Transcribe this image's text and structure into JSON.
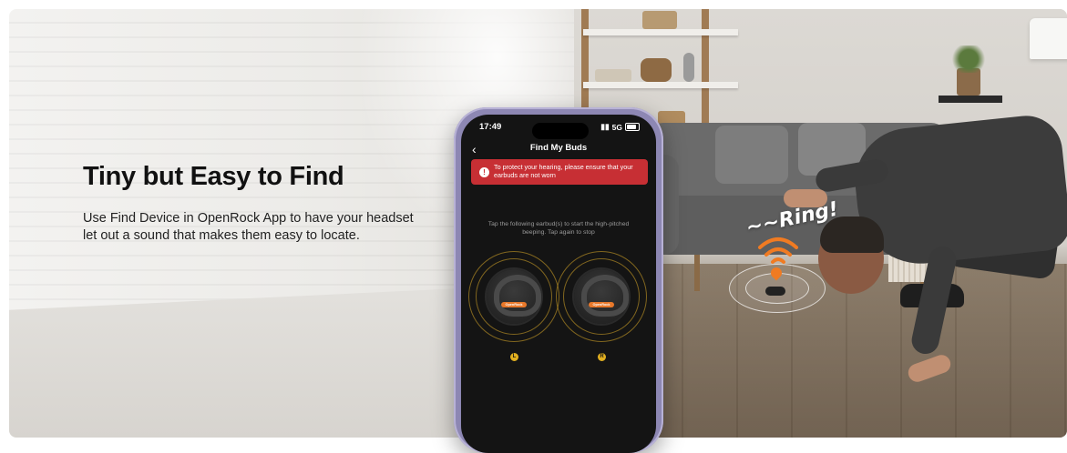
{
  "banner": {
    "headline": "Tiny but Easy to Find",
    "description": "Use Find Device in OpenRock App to have your headset let out a sound that makes them easy to locate.",
    "ring_text": "~~Ring!"
  },
  "phone": {
    "status_time": "17:49",
    "status_network": "5G",
    "nav_title": "Find My Buds",
    "alert_text": "To protect your hearing, please ensure that your earbuds are not worn",
    "instruction": "Tap the following earbud(s) to start the high-pitched beeping. Tap again to stop",
    "earbuds": [
      {
        "side": "L",
        "brand": "OpenRock"
      },
      {
        "side": "R",
        "brand": "OpenRock"
      }
    ]
  },
  "colors": {
    "alert_red": "#c72f34",
    "ring_gold": "#e2b020",
    "signal_orange": "#f07b22",
    "phone_frame": "#8d87b3"
  }
}
